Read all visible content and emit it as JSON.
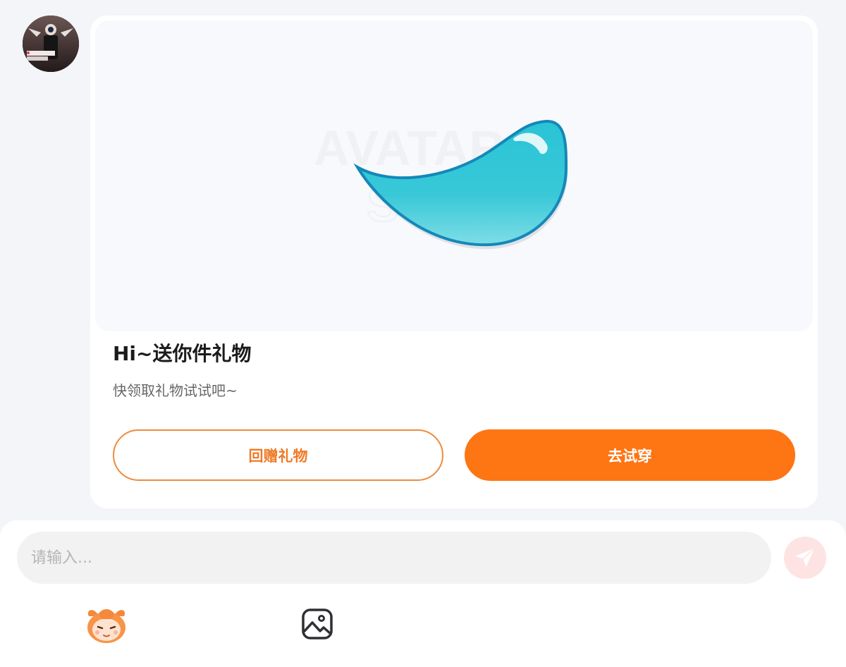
{
  "gift_card": {
    "title": "Hi~送你件礼物",
    "subtitle": "快领取礼物试试吧~",
    "watermark_line1": "AVATAR",
    "watermark_line2": "STORE",
    "return_gift_label": "回赠礼物",
    "try_on_label": "去试穿"
  },
  "composer": {
    "placeholder": "请输入..."
  },
  "icons": {
    "avatar": "user-avatar",
    "gift": "water-drop",
    "send": "paper-plane-icon",
    "emoji": "mascot-emoji-icon",
    "image": "image-icon"
  },
  "colors": {
    "accent": "#fe7514",
    "outline_button": "#ef8a3d",
    "send_bg": "#fde4e3",
    "page_bg": "#f3f5f8"
  }
}
